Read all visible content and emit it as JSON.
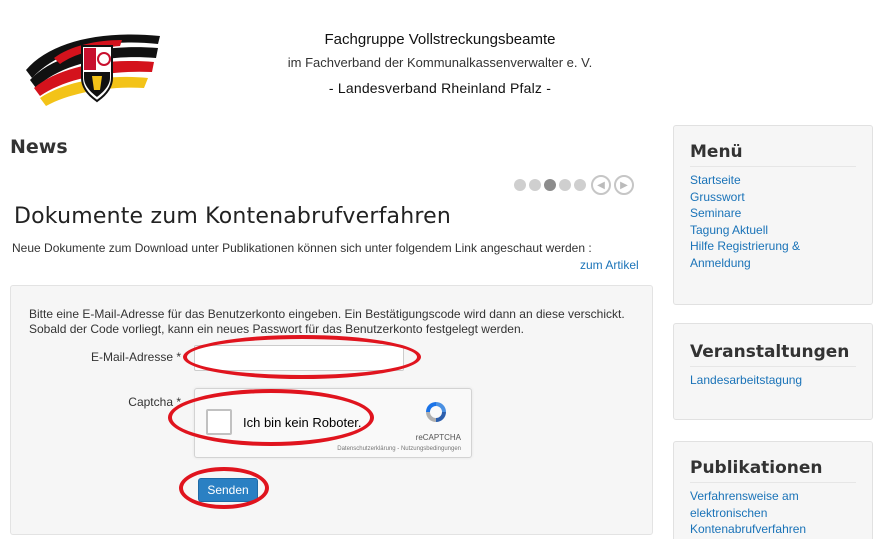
{
  "header": {
    "line1": "Fachgruppe Vollstreckungsbeamte",
    "line2": "im Fachverband der Kommunalkassenverwalter e. V.",
    "line3": "- Landesverband Rheinland Pfalz -"
  },
  "main": {
    "heading": "News",
    "article_title": "Dokumente zum Kontenabrufverfahren",
    "article_text": "Neue Dokumente zum Download unter Publikationen können sich unter folgendem Link angeschaut werden :",
    "article_link": "zum Artikel"
  },
  "form": {
    "description": "Bitte eine E-Mail-Adresse für das Benutzerkonto eingeben. Ein Bestätigungscode wird dann an diese verschickt. Sobald der Code vorliegt, kann ein neues Passwort für das Benutzerkonto festgelegt werden.",
    "email_label": "E-Mail-Adresse *",
    "email_value": "",
    "captcha_label": "Captcha *",
    "captcha_text": "Ich bin kein Roboter.",
    "captcha_brand": "reCAPTCHA",
    "captcha_terms": "Datenschutzerklärung - Nutzungsbedingungen",
    "submit_label": "Senden"
  },
  "sidebar": {
    "menu": {
      "title": "Menü",
      "items": [
        "Startseite",
        "Grusswort",
        "Seminare",
        "Tagung Aktuell",
        "Hilfe Registrierung & Anmeldung"
      ]
    },
    "events": {
      "title": "Veranstaltungen",
      "items": [
        "Landesarbeitstagung"
      ]
    },
    "publications": {
      "title": "Publikationen",
      "items": [
        "Verfahrensweise am elektronischen Kontenabrufverfahren"
      ]
    }
  },
  "colors": {
    "link": "#1a73b8",
    "button": "#2a80c3",
    "annotation": "#e0141e"
  },
  "icons": {
    "logo": "rhineland-palatinate-coat-of-arms-logo",
    "pager_prev": "circle-arrow-left-icon",
    "pager_next": "circle-arrow-right-icon",
    "captcha": "recaptcha-icon"
  }
}
